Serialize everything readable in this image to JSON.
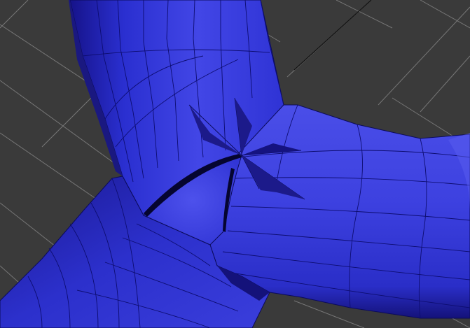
{
  "viewport": {
    "background_color": "#3a3a3a",
    "grid_color": "#8a8a8a",
    "mesh_color": "#2a2fcf",
    "mesh_highlight_color": "#5a5ef0",
    "mesh_shadow_color": "#14127a",
    "edge_color": "#0b0b5a"
  }
}
